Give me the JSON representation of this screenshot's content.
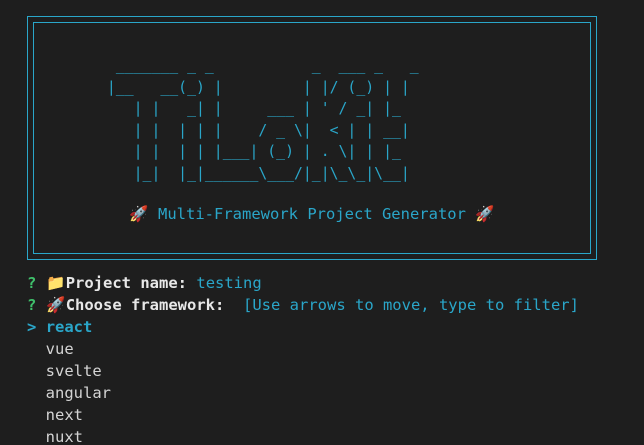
{
  "banner": {
    "ascii_art": "  _______ _ _           _  ___ _   _   \n |__   __(_) |         | |/ (_) | |  \n    | |   _| |     ___ | ' / _| |_   \n    | |  | | |    / _ \\|  < | | __|  \n    | |  | | |___| (_) | . \\| | |_   \n    |_|  |_|______\\___/|_|\\_\\_|\\__|  ",
    "subtitle_icon": "🚀",
    "subtitle": "Multi-Framework Project Generator",
    "subtitle_icon_right": "🚀"
  },
  "prompts": [
    {
      "marker": "?",
      "icon": "📁",
      "label": "Project name:",
      "value": "testing"
    },
    {
      "marker": "?",
      "icon": "🚀",
      "label": "Choose framework:",
      "hint": "[Use arrows to move, type to filter]"
    }
  ],
  "choices": {
    "pointer": ">",
    "selected": "react",
    "options": [
      "vue",
      "svelte",
      "angular",
      "next",
      "nuxt"
    ]
  },
  "colors": {
    "background": "#1e1e1e",
    "accent": "#2aa6c9",
    "question_mark": "#3fc06b",
    "text": "#d4d4d4"
  }
}
